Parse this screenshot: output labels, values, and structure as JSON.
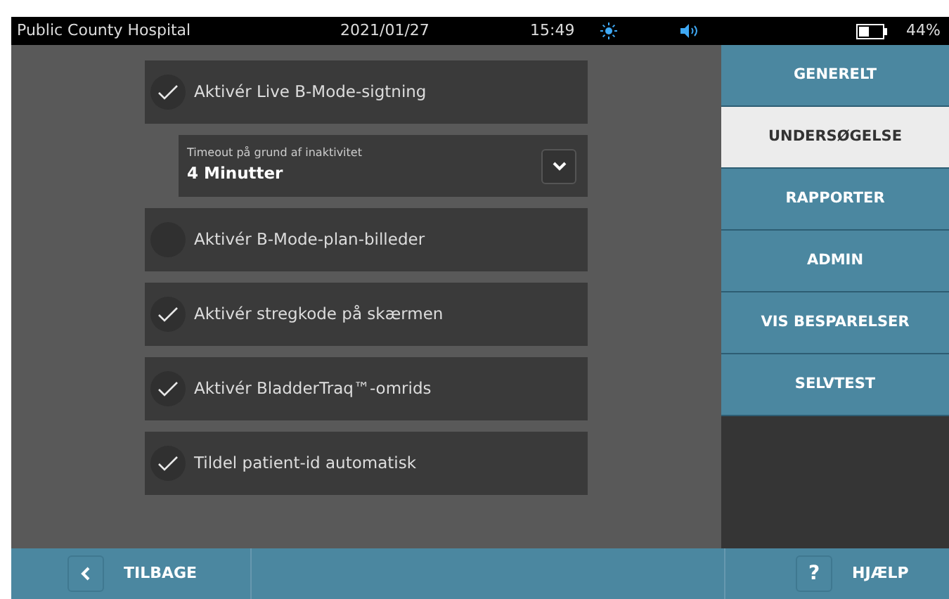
{
  "status_bar": {
    "facility": "Public County Hospital",
    "date": "2021/01/27",
    "time": "15:49",
    "battery": "44%"
  },
  "settings": [
    {
      "kind": "toggle",
      "label": "Aktivér Live B-Mode-sigtning",
      "checked": true
    },
    {
      "kind": "dropdown",
      "caption": "Timeout på grund af inaktivitet",
      "value": "4 Minutter"
    },
    {
      "kind": "toggle",
      "label": "Aktivér B-Mode-plan-billeder",
      "checked": false
    },
    {
      "kind": "toggle",
      "label": "Aktivér stregkode på skærmen",
      "checked": true
    },
    {
      "kind": "toggle",
      "label": "Aktivér BladderTraq™-omrids",
      "checked": true
    },
    {
      "kind": "toggle",
      "label": "Tildel patient-id automatisk",
      "checked": true
    }
  ],
  "tabs": [
    {
      "label": "GENERELT",
      "selected": false
    },
    {
      "label": "UNDERSØGELSE",
      "selected": true
    },
    {
      "label": "RAPPORTER",
      "selected": false
    },
    {
      "label": "ADMIN",
      "selected": false
    },
    {
      "label": "VIS BESPARELSER",
      "selected": false
    },
    {
      "label": "SELVTEST",
      "selected": false
    }
  ],
  "footer": {
    "back": "TILBAGE",
    "help_icon": "?",
    "help": "HJÆLP"
  }
}
